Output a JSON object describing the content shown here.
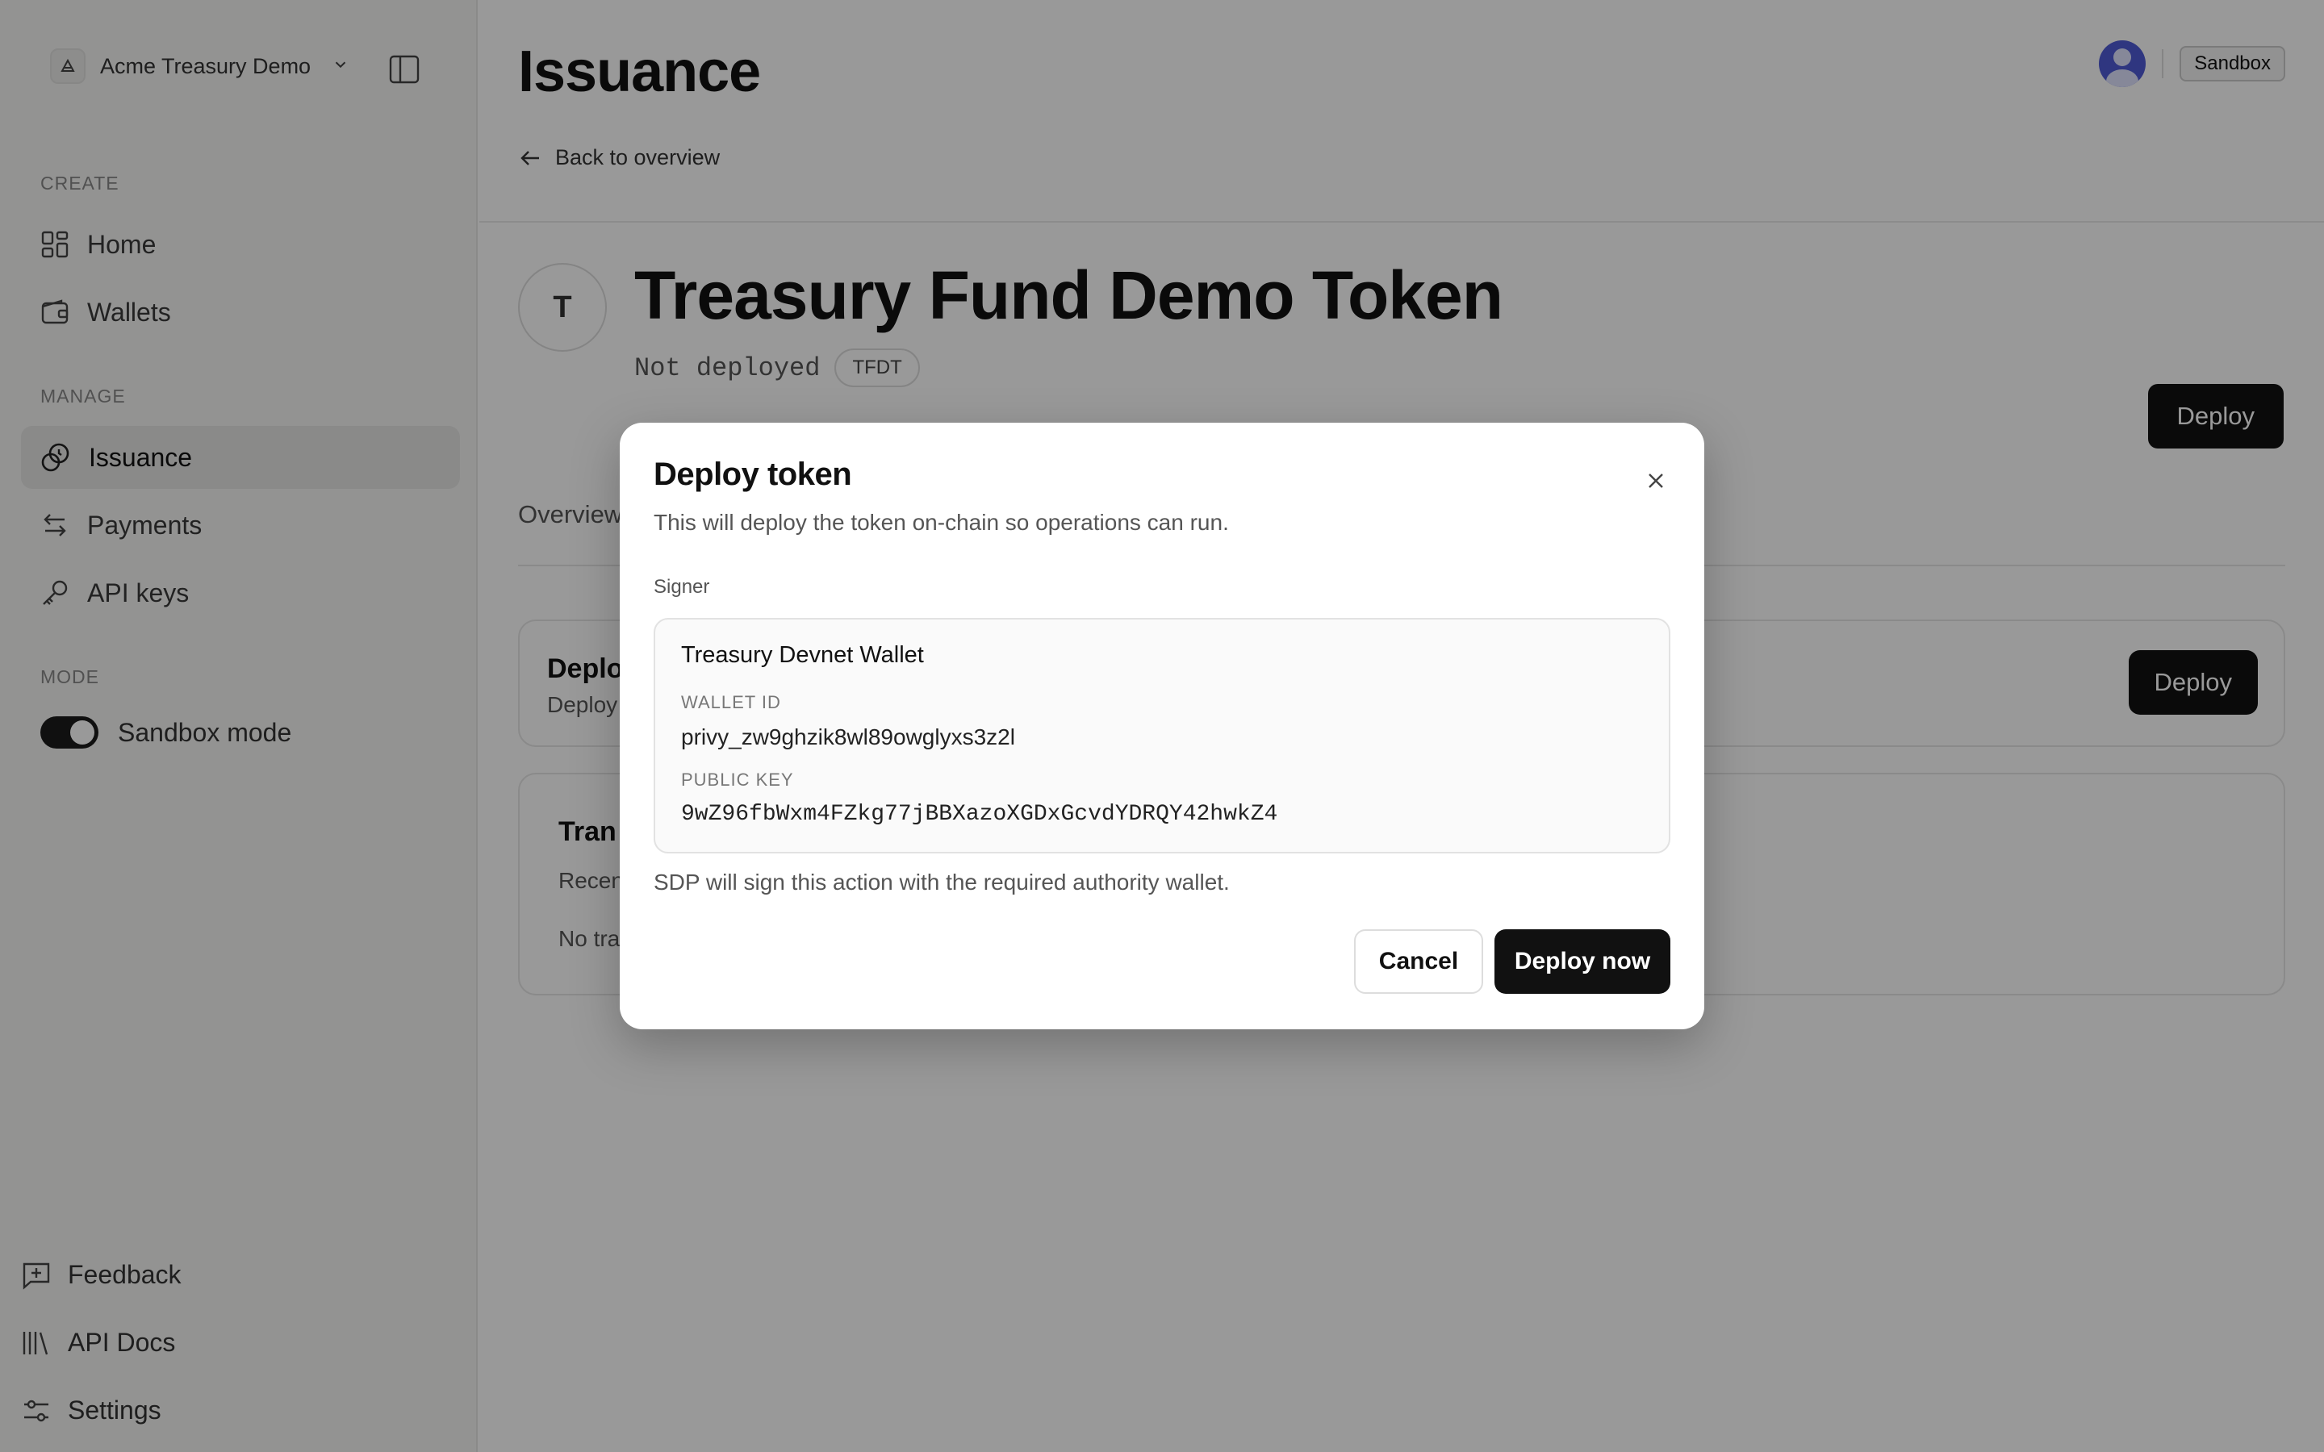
{
  "sidebar": {
    "org_name": "Acme Treasury Demo",
    "sections": {
      "create": "CREATE",
      "manage": "MANAGE",
      "mode": "MODE"
    },
    "items": {
      "home": "Home",
      "wallets": "Wallets",
      "issuance": "Issuance",
      "payments": "Payments",
      "api_keys": "API keys"
    },
    "sandbox_toggle": {
      "label": "Sandbox mode",
      "on": true
    },
    "bottom": {
      "feedback": "Feedback",
      "api_docs": "API Docs",
      "settings": "Settings"
    }
  },
  "header": {
    "title": "Issuance",
    "back_link": "Back to overview",
    "env_badge": "Sandbox"
  },
  "token": {
    "initial": "T",
    "name": "Treasury Fund Demo Token",
    "status": "Not deployed",
    "symbol": "TFDT",
    "deploy_label": "Deploy"
  },
  "tabs": {
    "overview": "Overview"
  },
  "cards": {
    "deploy": {
      "title": "Deplo",
      "subtitle": "Deploy",
      "button": "Deploy"
    },
    "transactions": {
      "title": "Tran",
      "subtitle": "Recen",
      "empty": "No tra"
    }
  },
  "modal": {
    "title": "Deploy token",
    "description": "This will deploy the token on-chain so operations can run.",
    "signer_label": "Signer",
    "wallet_name": "Treasury Devnet Wallet",
    "wallet_id_label": "WALLET ID",
    "wallet_id": "privy_zw9ghzik8wl89owglyxs3z2l",
    "public_key_label": "PUBLIC KEY",
    "public_key": "9wZ96fbWxm4FZkg77jBBXazoXGDxGcvdYDRQY42hwkZ4",
    "note": "SDP will sign this action with the required authority wallet.",
    "cancel_label": "Cancel",
    "confirm_label": "Deploy now"
  },
  "colors": {
    "accent": "#111111",
    "avatar": "#4f5bd5",
    "overlay": "rgba(0,0,0,0.40)"
  }
}
